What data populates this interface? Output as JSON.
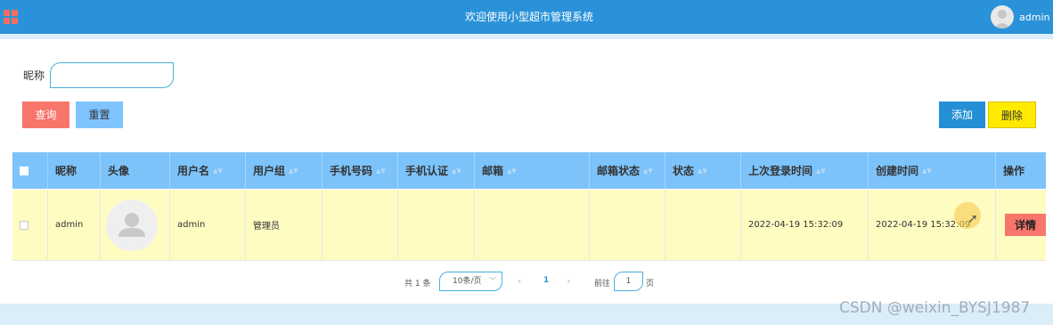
{
  "header": {
    "title": "欢迎使用小型超市管理系统",
    "username": "admin",
    "background_color": "#2a92d8"
  },
  "search": {
    "label": "昵称",
    "value": "",
    "placeholder": "",
    "query_label": "查询",
    "reset_label": "重置"
  },
  "actions": {
    "add_label": "添加",
    "delete_label": "删除"
  },
  "table": {
    "columns": [
      "昵称",
      "头像",
      "用户名",
      "用户组",
      "手机号码",
      "手机认证",
      "邮箱",
      "邮箱状态",
      "状态",
      "上次登录时间",
      "创建时间",
      "操作"
    ],
    "sortable": [
      false,
      false,
      true,
      true,
      true,
      true,
      true,
      true,
      true,
      true,
      true,
      false
    ],
    "rows": [
      {
        "nickname": "admin",
        "avatar": "user-avatar-placeholder",
        "username": "admin",
        "group": "管理员",
        "phone": "",
        "phone_verified": "",
        "email": "",
        "email_status": "",
        "status": "",
        "last_login": "2022-04-19 15:32:09",
        "created": "2022-04-19 15:32:09",
        "action_label": "详情"
      }
    ]
  },
  "pagination": {
    "total_text": "共 1 条",
    "page_size": "10条/页",
    "current_page": "1",
    "goto_label": "前往",
    "goto_value": "1",
    "page_unit": "页"
  },
  "watermark": "CSDN @weixin_BYSJ1987",
  "colors": {
    "query": "#f8756b",
    "reset": "#7fc3ff",
    "add": "#258fd5",
    "delete": "#ffea00",
    "table_header": "#7cc3fb",
    "row_highlight": "#fffcc2"
  }
}
